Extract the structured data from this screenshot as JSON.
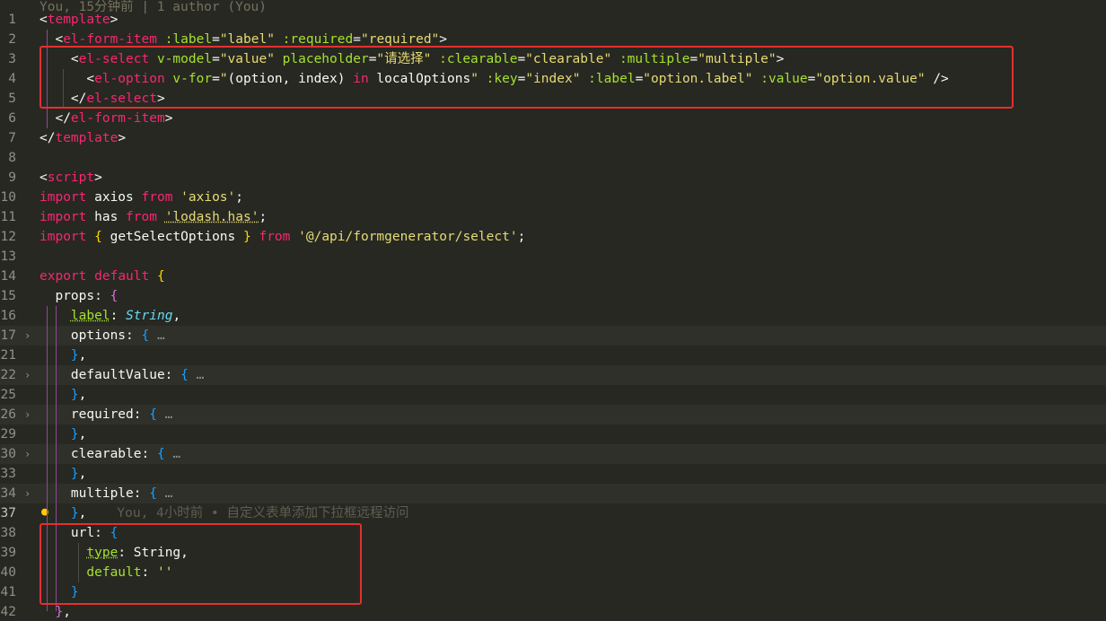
{
  "codelens": "You, 15分钟前 | 1 author (You)",
  "blame": "You, 4小时前 • 自定义表单添加下拉框远程访问",
  "lines": [
    {
      "n": "1",
      "tokens": [
        [
          "p",
          "<"
        ],
        [
          "t",
          "template"
        ],
        [
          "p",
          ">"
        ]
      ]
    },
    {
      "n": "2",
      "tokens": [
        [
          "p",
          "  <"
        ],
        [
          "t",
          "el-form-item"
        ],
        [
          "p",
          " "
        ],
        [
          "a",
          ":label"
        ],
        [
          "p",
          "="
        ],
        [
          "s",
          "\"label\""
        ],
        [
          "p",
          " "
        ],
        [
          "a",
          ":required"
        ],
        [
          "p",
          "="
        ],
        [
          "s",
          "\"required\""
        ],
        [
          "p",
          ">"
        ]
      ]
    },
    {
      "n": "3",
      "tokens": [
        [
          "p",
          "    <"
        ],
        [
          "t",
          "el-select"
        ],
        [
          "p",
          " "
        ],
        [
          "a",
          "v-model"
        ],
        [
          "p",
          "="
        ],
        [
          "s",
          "\"value\""
        ],
        [
          "p",
          " "
        ],
        [
          "a",
          "placeholder"
        ],
        [
          "p",
          "="
        ],
        [
          "s",
          "\"请选择\""
        ],
        [
          "p",
          " "
        ],
        [
          "a",
          ":clearable"
        ],
        [
          "p",
          "="
        ],
        [
          "s",
          "\"clearable\""
        ],
        [
          "p",
          " "
        ],
        [
          "a",
          ":multiple"
        ],
        [
          "p",
          "="
        ],
        [
          "s",
          "\"multiple\""
        ],
        [
          "p",
          ">"
        ]
      ]
    },
    {
      "n": "4",
      "tokens": [
        [
          "p",
          "      <"
        ],
        [
          "t",
          "el-option"
        ],
        [
          "p",
          " "
        ],
        [
          "a",
          "v-for"
        ],
        [
          "p",
          "="
        ],
        [
          "s",
          "\""
        ],
        [
          "p",
          "(option, index) "
        ],
        [
          "k",
          "in"
        ],
        [
          "p",
          " localOptions"
        ],
        [
          "s",
          "\""
        ],
        [
          "p",
          " "
        ],
        [
          "a",
          ":key"
        ],
        [
          "p",
          "="
        ],
        [
          "s",
          "\"index\""
        ],
        [
          "p",
          " "
        ],
        [
          "a",
          ":label"
        ],
        [
          "p",
          "="
        ],
        [
          "s",
          "\"option.label\""
        ],
        [
          "p",
          " "
        ],
        [
          "a",
          ":value"
        ],
        [
          "p",
          "="
        ],
        [
          "s",
          "\"option.value\""
        ],
        [
          "p",
          " />"
        ]
      ]
    },
    {
      "n": "5",
      "tokens": [
        [
          "p",
          "    </"
        ],
        [
          "t",
          "el-select"
        ],
        [
          "p",
          ">"
        ]
      ]
    },
    {
      "n": "6",
      "tokens": [
        [
          "p",
          "  </"
        ],
        [
          "t",
          "el-form-item"
        ],
        [
          "p",
          ">"
        ]
      ]
    },
    {
      "n": "7",
      "tokens": [
        [
          "p",
          "</"
        ],
        [
          "t",
          "template"
        ],
        [
          "p",
          ">"
        ]
      ]
    },
    {
      "n": "8",
      "tokens": []
    },
    {
      "n": "9",
      "tokens": [
        [
          "p",
          "<"
        ],
        [
          "t",
          "script"
        ],
        [
          "p",
          ">"
        ]
      ]
    },
    {
      "n": "10",
      "tokens": [
        [
          "k",
          "import"
        ],
        [
          "p",
          " axios "
        ],
        [
          "k",
          "from"
        ],
        [
          "p",
          " "
        ],
        [
          "s",
          "'axios'"
        ],
        [
          "p",
          ";"
        ]
      ]
    },
    {
      "n": "11",
      "tokens": [
        [
          "k",
          "import"
        ],
        [
          "p",
          " has "
        ],
        [
          "k",
          "from"
        ],
        [
          "p",
          " "
        ],
        [
          "s u2",
          "'lodash.has'"
        ],
        [
          "p",
          ";"
        ]
      ]
    },
    {
      "n": "12",
      "tokens": [
        [
          "k",
          "import"
        ],
        [
          "p",
          " "
        ],
        [
          "b1",
          "{"
        ],
        [
          "p",
          " getSelectOptions "
        ],
        [
          "b1",
          "}"
        ],
        [
          "p",
          " "
        ],
        [
          "k",
          "from"
        ],
        [
          "p",
          " "
        ],
        [
          "s",
          "'@/api/formgenerator/select'"
        ],
        [
          "p",
          ";"
        ]
      ]
    },
    {
      "n": "13",
      "tokens": []
    },
    {
      "n": "14",
      "tokens": [
        [
          "k",
          "export"
        ],
        [
          "p",
          " "
        ],
        [
          "k",
          "default"
        ],
        [
          "p",
          " "
        ],
        [
          "b1",
          "{"
        ]
      ]
    },
    {
      "n": "15",
      "tokens": [
        [
          "p",
          "  props: "
        ],
        [
          "b2",
          "{"
        ]
      ]
    },
    {
      "n": "16",
      "tokens": [
        [
          "p",
          "    "
        ],
        [
          "a u",
          "label"
        ],
        [
          "p",
          ": "
        ],
        [
          "i",
          "String"
        ],
        [
          "p",
          ","
        ]
      ]
    },
    {
      "n": "17",
      "fold": true,
      "tokens": [
        [
          "p",
          "    options: "
        ],
        [
          "b3",
          "{"
        ],
        [
          "el",
          " …"
        ]
      ]
    },
    {
      "n": "21",
      "tokens": [
        [
          "p",
          "    "
        ],
        [
          "b3",
          "}"
        ],
        [
          "p",
          ","
        ]
      ]
    },
    {
      "n": "22",
      "fold": true,
      "tokens": [
        [
          "p",
          "    defaultValue: "
        ],
        [
          "b3",
          "{"
        ],
        [
          "el",
          " …"
        ]
      ]
    },
    {
      "n": "25",
      "tokens": [
        [
          "p",
          "    "
        ],
        [
          "b3",
          "}"
        ],
        [
          "p",
          ","
        ]
      ]
    },
    {
      "n": "26",
      "fold": true,
      "tokens": [
        [
          "p",
          "    required: "
        ],
        [
          "b3",
          "{"
        ],
        [
          "el",
          " …"
        ]
      ]
    },
    {
      "n": "29",
      "tokens": [
        [
          "p",
          "    "
        ],
        [
          "b3",
          "}"
        ],
        [
          "p",
          ","
        ]
      ]
    },
    {
      "n": "30",
      "fold": true,
      "tokens": [
        [
          "p",
          "    clearable: "
        ],
        [
          "b3",
          "{"
        ],
        [
          "el",
          " …"
        ]
      ]
    },
    {
      "n": "33",
      "tokens": [
        [
          "p",
          "    "
        ],
        [
          "b3",
          "}"
        ],
        [
          "p",
          ","
        ]
      ]
    },
    {
      "n": "34",
      "fold": true,
      "tokens": [
        [
          "p",
          "    multiple: "
        ],
        [
          "b3",
          "{"
        ],
        [
          "el",
          " …"
        ]
      ]
    },
    {
      "n": "37",
      "cur": true,
      "blame": true,
      "tokens": [
        [
          "p",
          "    "
        ],
        [
          "b3",
          "}"
        ],
        [
          "p",
          ","
        ]
      ]
    },
    {
      "n": "38",
      "tokens": [
        [
          "p",
          "    url: "
        ],
        [
          "b3",
          "{"
        ]
      ]
    },
    {
      "n": "39",
      "tokens": [
        [
          "p",
          "      "
        ],
        [
          "a u",
          "type"
        ],
        [
          "p",
          ": String,"
        ]
      ]
    },
    {
      "n": "40",
      "tokens": [
        [
          "p",
          "      "
        ],
        [
          "a",
          "default"
        ],
        [
          "p",
          ": "
        ],
        [
          "s",
          "''"
        ]
      ]
    },
    {
      "n": "41",
      "tokens": [
        [
          "p",
          "    "
        ],
        [
          "b3",
          "}"
        ]
      ]
    },
    {
      "n": "42",
      "tokens": [
        [
          "p",
          "  "
        ],
        [
          "b2",
          "}"
        ],
        [
          "p",
          ","
        ]
      ]
    }
  ]
}
